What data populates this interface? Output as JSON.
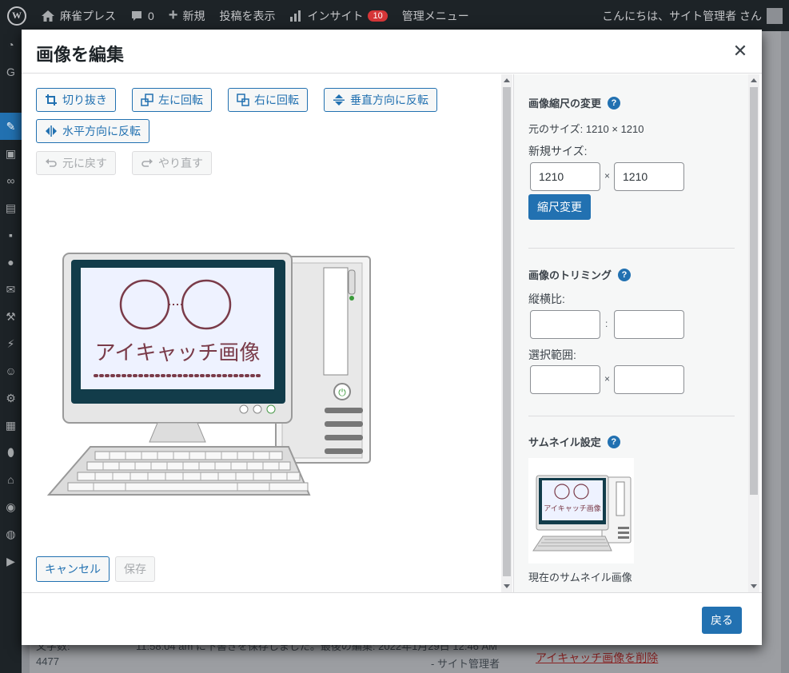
{
  "adminbar": {
    "site_name": "麻雀プレス",
    "comments_count": "0",
    "new_label": "新規",
    "view_post_label": "投稿を表示",
    "insights_label": "インサイト",
    "insights_badge": "10",
    "admin_menu_label": "管理メニュー",
    "greeting": "こんにちは、サイト管理者 さん"
  },
  "background": {
    "word_count_label": "文字数:",
    "word_count": "4477",
    "autosave_text": "11:58:04 am に下書きを保存しました。最後の編集: 2022年1月29日 12:46 AM",
    "author": "- サイト管理者",
    "remove_featured": "アイキャッチ画像を削除"
  },
  "modal": {
    "title": "画像を編集",
    "toolbar": {
      "crop": "切り抜き",
      "rotate_left": "左に回転",
      "rotate_right": "右に回転",
      "flip_vertical": "垂直方向に反転",
      "flip_horizontal": "水平方向に反転",
      "undo": "元に戻す",
      "redo": "やり直す"
    },
    "image_caption": "アイキャッチ画像",
    "cancel": "キャンセル",
    "save": "保存",
    "back": "戻る",
    "scale": {
      "title": "画像縮尺の変更",
      "original_size": "元のサイズ: 1210 × 1210",
      "new_size_label": "新規サイズ:",
      "width": "1210",
      "height": "1210",
      "times": "×",
      "button": "縮尺変更"
    },
    "crop_section": {
      "title": "画像のトリミング",
      "aspect_label": "縦横比:",
      "aspect_sep": ":",
      "selection_label": "選択範囲:",
      "selection_sep": "×"
    },
    "thumbnail": {
      "title": "サムネイル設定",
      "current_label": "現在のサムネイル画像",
      "image_caption": "アイキャッチ画像"
    }
  },
  "colors": {
    "accent": "#2271b1",
    "admin_bar": "#1d2327"
  }
}
